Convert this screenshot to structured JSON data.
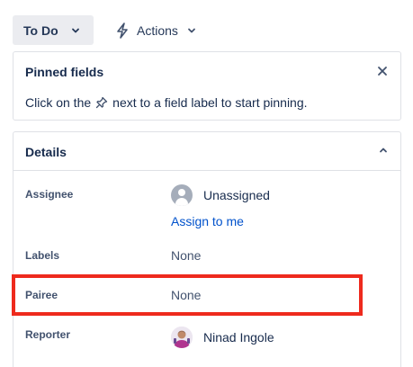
{
  "toolbar": {
    "status_label": "To Do",
    "actions_label": "Actions"
  },
  "pinned": {
    "title": "Pinned fields",
    "message_before": "Click on the",
    "message_after": "next to a field label to start pinning."
  },
  "details": {
    "title": "Details",
    "fields": {
      "assignee": {
        "label": "Assignee",
        "value": "Unassigned",
        "action": "Assign to me"
      },
      "labels": {
        "label": "Labels",
        "value": "None"
      },
      "pairee": {
        "label": "Pairee",
        "value": "None"
      },
      "reporter": {
        "label": "Reporter",
        "value": "Ninad Ingole"
      }
    }
  },
  "colors": {
    "accent": "#0052cc",
    "highlight": "#ee2a1d",
    "status_bg": "#ebecf0"
  },
  "icons": [
    "chevron-down-icon",
    "lightning-bolt-icon",
    "close-icon",
    "pin-icon",
    "chevron-up-icon",
    "default-avatar-icon",
    "user-avatar"
  ]
}
